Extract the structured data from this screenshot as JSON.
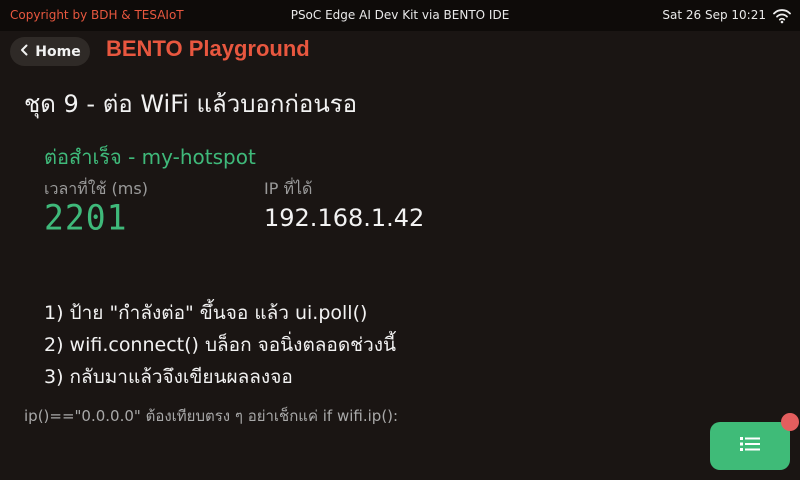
{
  "topbar": {
    "copyright": "Copyright by BDH & TESAIoT",
    "title": "PSoC Edge AI Dev Kit via BENTO IDE",
    "datetime": "Sat 26 Sep 10:21",
    "wifi_icon": "wifi-icon"
  },
  "nav": {
    "home_label": "Home",
    "app_title": "BENTO Playground"
  },
  "page": {
    "heading": "ชุด 9 - ต่อ WiFi แล้วบอกก่อนรอ",
    "status": "ต่อสำเร็จ - my-hotspot",
    "time_label": "เวลาที่ใช้ (ms)",
    "time_value": "2201",
    "ip_label": "IP ที่ได้",
    "ip_value": "192.168.1.42",
    "steps": [
      "1) ป้าย \"กำลังต่อ\" ขึ้นจอ แล้ว ui.poll()",
      "2) wifi.connect() บล็อก จอนิ่งตลอดช่วงนี้",
      "3) กลับมาแล้วจึงเขียนผลลงจอ"
    ],
    "note": "ip()==\"0.0.0.0\" ต้องเทียบตรง ๆ อย่าเช็กแค่ if wifi.ip():"
  },
  "fab": {
    "icon": "list-icon"
  },
  "colors": {
    "background": "#1a1513",
    "accent_red": "#e8573f",
    "accent_green": "#3fb97a",
    "badge": "#e35e5e"
  }
}
